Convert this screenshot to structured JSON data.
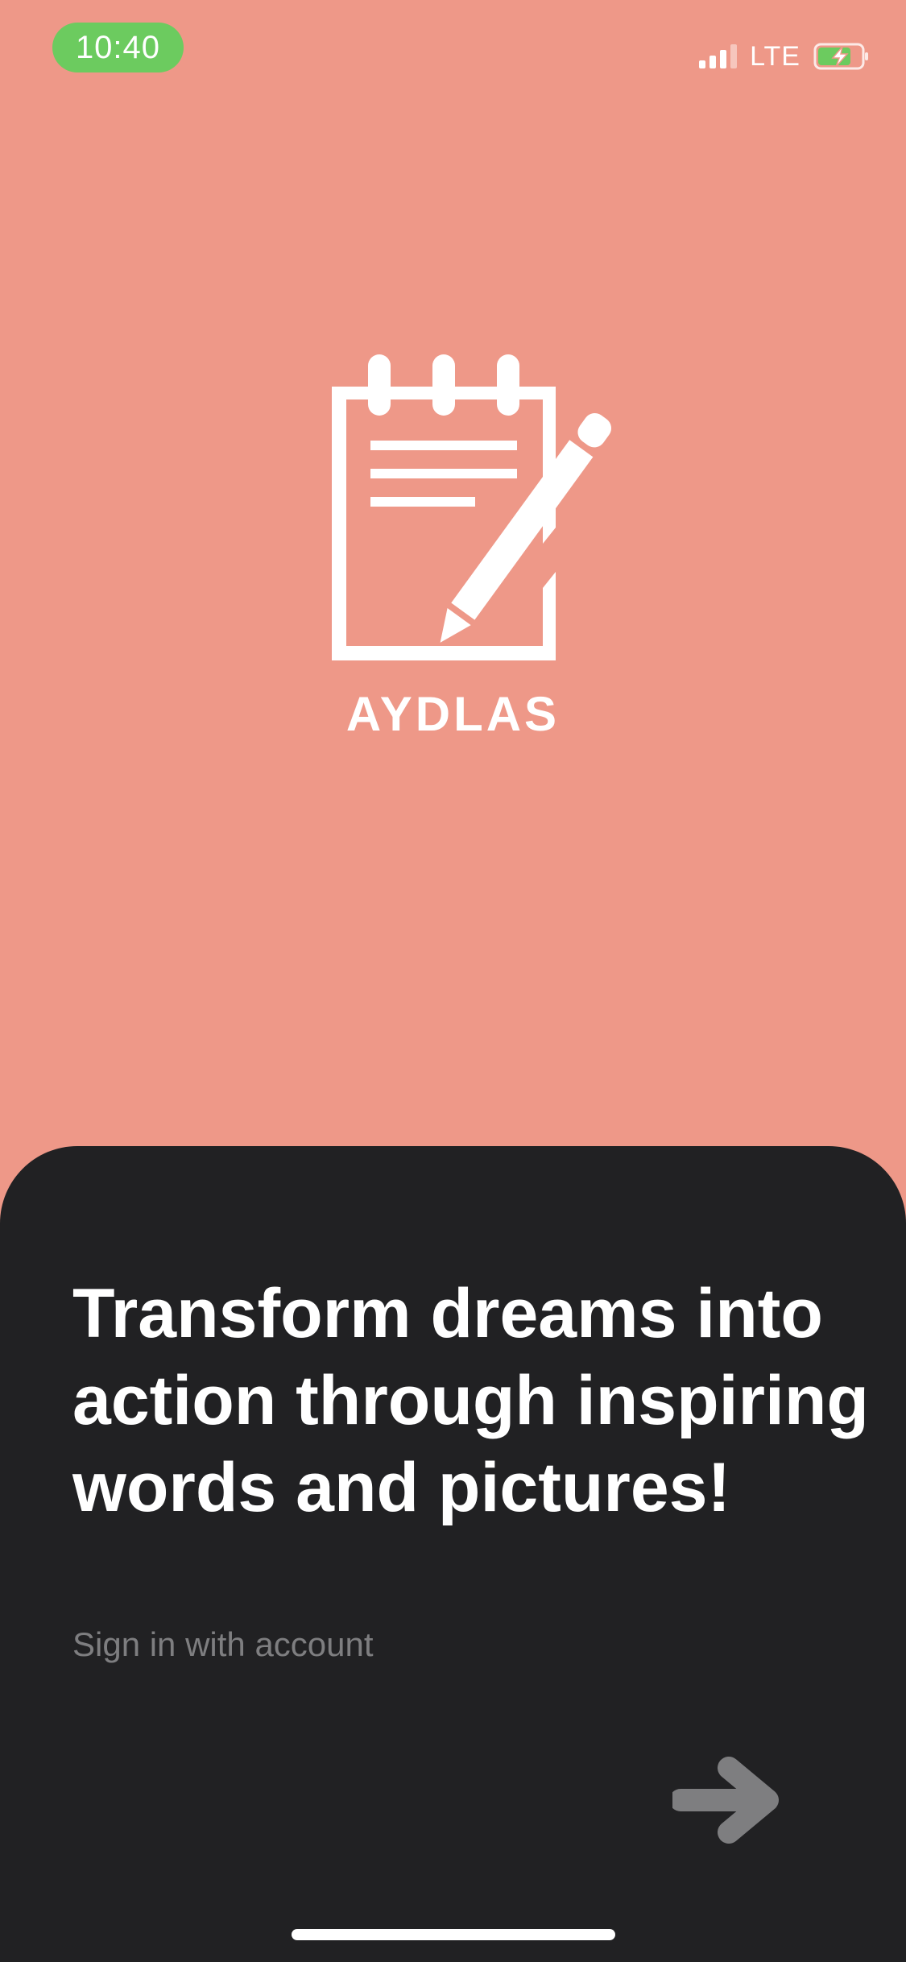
{
  "status_bar": {
    "time": "10:40",
    "network": "LTE",
    "time_pill_color": "#6CCB5F",
    "icons": [
      "signal-icon",
      "battery-charging-icon"
    ]
  },
  "logo": {
    "icon": "notepad-pencil-icon",
    "brand_name": "AYDLAS"
  },
  "onboarding": {
    "headline": "Transform dreams into action through inspiring words and pictures!",
    "subtitle": "Sign in with account",
    "next_icon": "arrow-right-icon"
  },
  "colors": {
    "background": "#EE9888",
    "sheet": "#212123",
    "subtitle": "#7E7E80",
    "arrow": "#7E7E80"
  }
}
